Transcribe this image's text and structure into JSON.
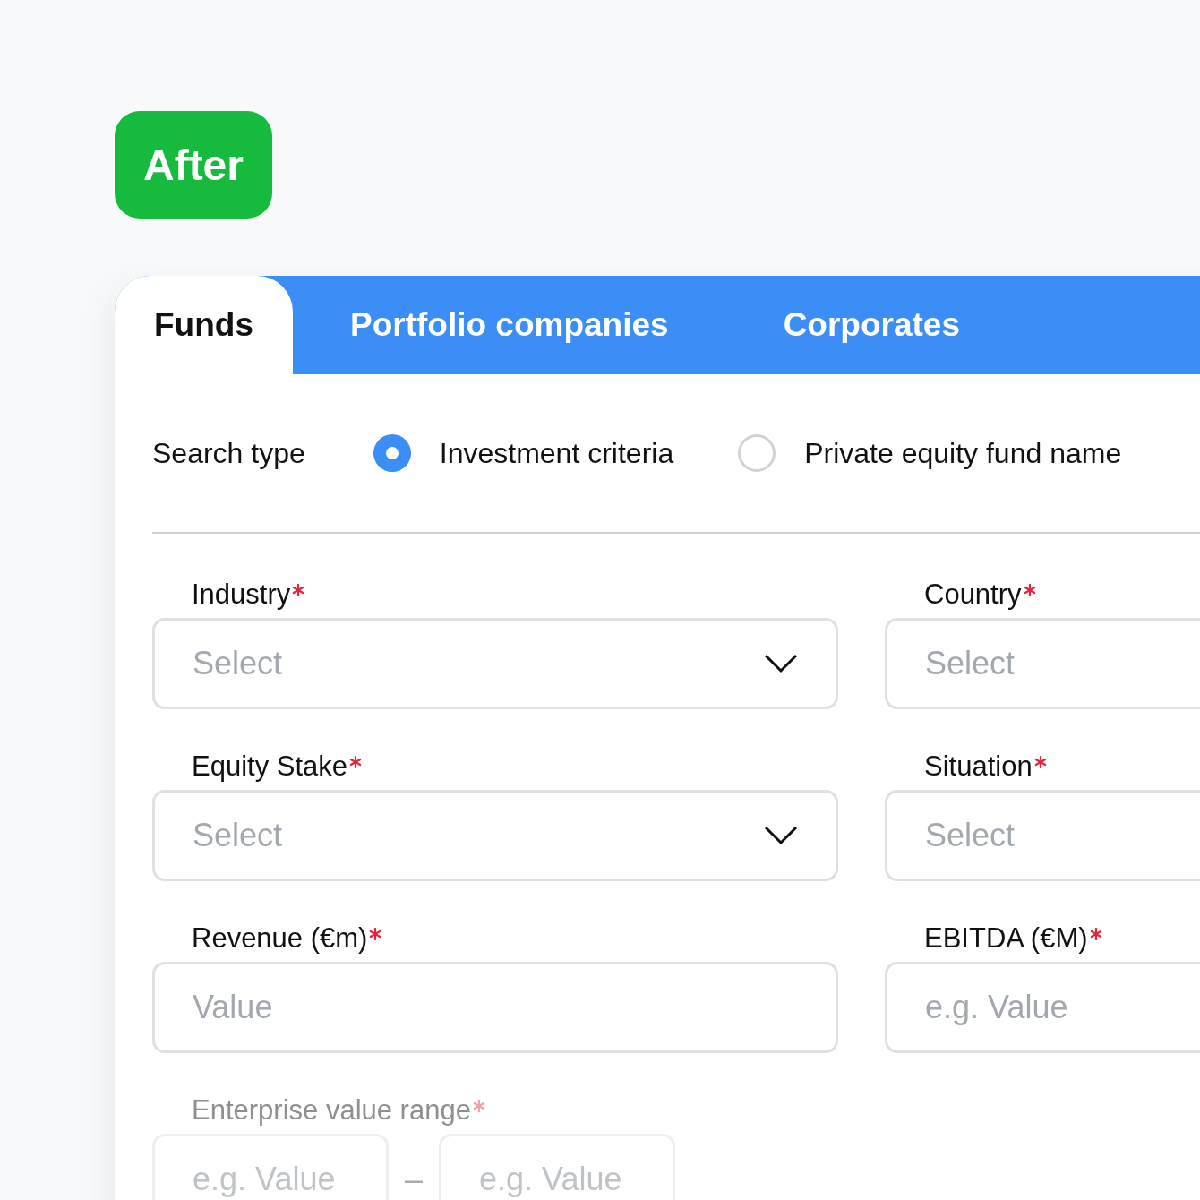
{
  "badge": {
    "label": "After"
  },
  "tabs": [
    {
      "label": "Funds",
      "selected": true
    },
    {
      "label": "Portfolio companies",
      "selected": false
    },
    {
      "label": "Corporates",
      "selected": false
    }
  ],
  "search_type": {
    "label": "Search type",
    "options": [
      {
        "label": "Investment criteria",
        "selected": true
      },
      {
        "label": "Private equity fund name",
        "selected": false
      }
    ]
  },
  "fields": [
    {
      "label": "Industry",
      "required": true,
      "kind": "select",
      "placeholder": "Select"
    },
    {
      "label": "Country",
      "required": true,
      "kind": "select",
      "placeholder": "Select"
    },
    {
      "label": "Equity Stake",
      "required": true,
      "kind": "select",
      "placeholder": "Select"
    },
    {
      "label": "Situation",
      "required": true,
      "kind": "select",
      "placeholder": "Select"
    },
    {
      "label": "Revenue (€m)",
      "required": true,
      "kind": "text",
      "placeholder": "Value"
    },
    {
      "label": "EBITDA (€M)",
      "required": true,
      "kind": "text",
      "placeholder": "e.g. Value"
    }
  ],
  "range": {
    "label": "Enterprise value range",
    "required": true,
    "from_placeholder": "e.g. Value",
    "separator": "–",
    "to_placeholder": "e.g. Value"
  }
}
